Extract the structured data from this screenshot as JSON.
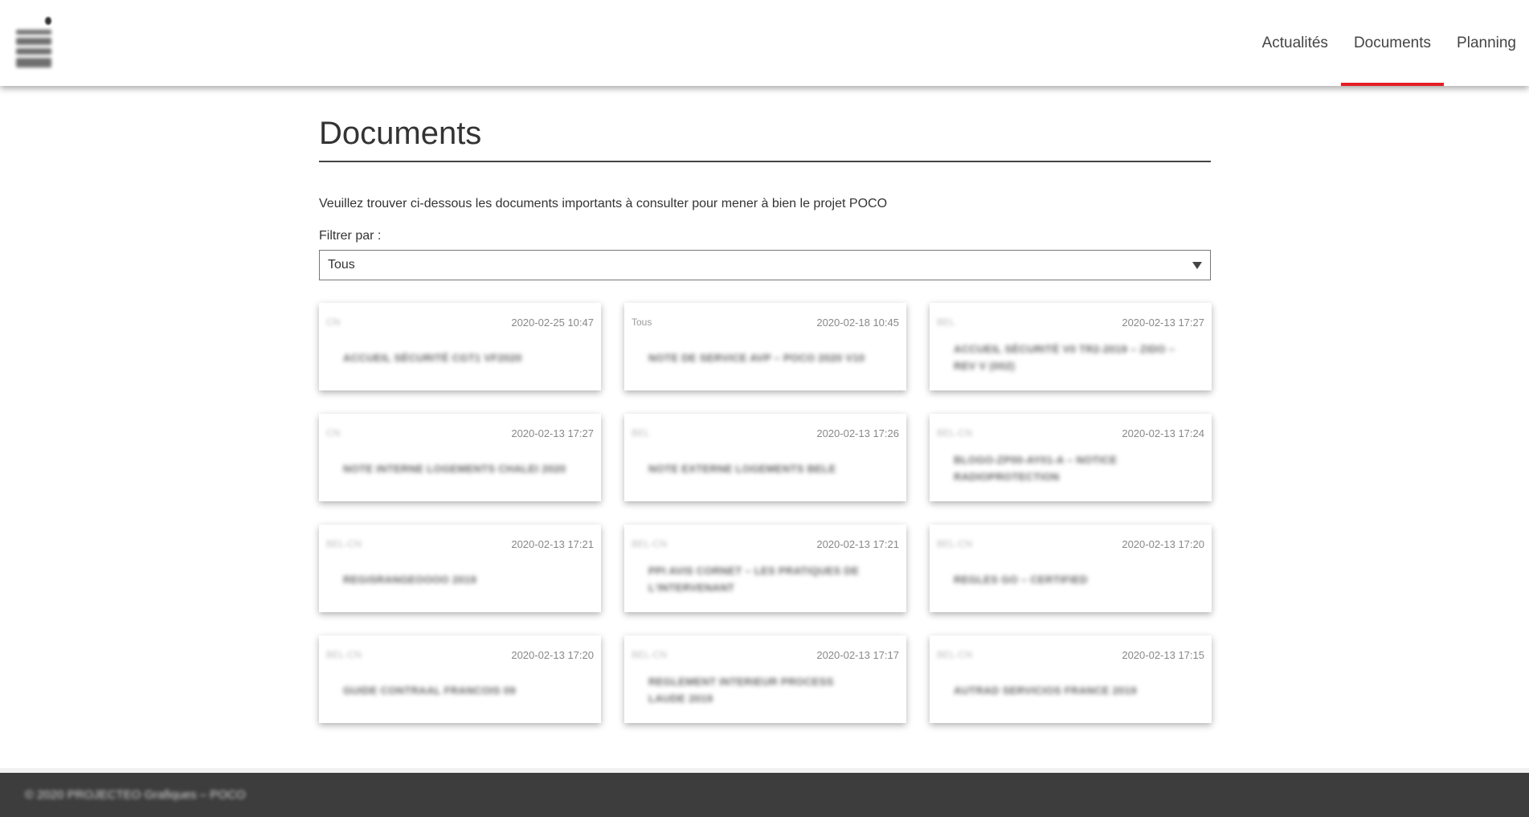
{
  "header": {
    "nav": [
      {
        "label": "Actualités",
        "active": false
      },
      {
        "label": "Documents",
        "active": true
      },
      {
        "label": "Planning",
        "active": false
      }
    ],
    "active_color": "#e41e26"
  },
  "main": {
    "title": "Documents",
    "intro": "Veuillez trouver ci-dessous les documents importants à consulter pour mener à bien le projet POCO",
    "filter_label": "Filtrer par :",
    "filter_value": "Tous"
  },
  "cards": [
    {
      "category": "CN",
      "date": "2020-02-25 10:47",
      "name": "ACCUEIL SÉCURITÉ CGT1 VF2020"
    },
    {
      "category": "Tous",
      "date": "2020-02-18 10:45",
      "name": "NOTE DE SERVICE AVP – POCO 2020 V10"
    },
    {
      "category": "BEL",
      "date": "2020-02-13 17:27",
      "name": "ACCUEIL SÉCURITÉ V0 TR2-2019 – ZIDO – REV V (002)"
    },
    {
      "category": "CN",
      "date": "2020-02-13 17:27",
      "name": "NOTE INTERNE LOGEMENTS CHALEI 2020"
    },
    {
      "category": "BEL",
      "date": "2020-02-13 17:26",
      "name": "NOTE EXTERNE LOGEMENTS BELE"
    },
    {
      "category": "BEL-CN",
      "date": "2020-02-13 17:24",
      "name": "BLOGO-ZP00-AY01-A – NOTICE RADIOPROTECTION"
    },
    {
      "category": "BEL-CN",
      "date": "2020-02-13 17:21",
      "name": "REGISRANGEOOOO 2019"
    },
    {
      "category": "BEL-CN",
      "date": "2020-02-13 17:21",
      "name": "PPI AVIS CORNET – LES PRATIQUES DE L'INTERVENANT"
    },
    {
      "category": "BEL-CN",
      "date": "2020-02-13 17:20",
      "name": "REGLES GO – CERTIFIED"
    },
    {
      "category": "BEL-CN",
      "date": "2020-02-13 17:20",
      "name": "GUIDE CONTRAAL FRANCOIS 09"
    },
    {
      "category": "BEL-CN",
      "date": "2020-02-13 17:17",
      "name": "REGLEMENT INTERIEUR PROCESS LAUDE 2019"
    },
    {
      "category": "BEL-CN",
      "date": "2020-02-13 17:15",
      "name": "AUTRAD SERVICIOS FRANCE 2019"
    }
  ],
  "footer": {
    "text": "© 2020 PROJECTEO Grafiques – POCO"
  }
}
